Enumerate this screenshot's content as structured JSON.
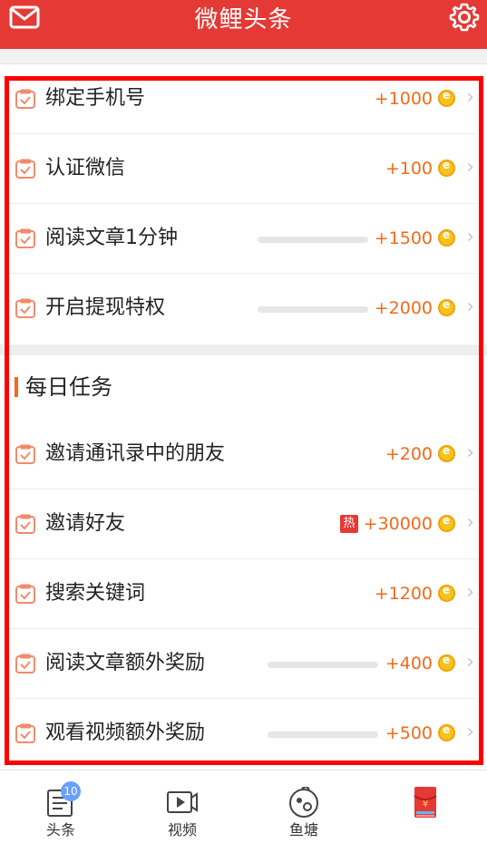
{
  "header": {
    "title": "微鲤头条",
    "left_icon": "mail-icon",
    "right_icon": "gear-icon",
    "bg_color": "#e53935"
  },
  "tasks_new": [
    {
      "label": "绑定手机号",
      "reward": "+1000",
      "has_progress": false
    },
    {
      "label": "认证微信",
      "reward": "+100",
      "has_progress": false
    },
    {
      "label": "阅读文章1分钟",
      "reward": "+1500",
      "has_progress": true
    },
    {
      "label": "开启提现特权",
      "reward": "+2000",
      "has_progress": true
    }
  ],
  "daily": {
    "title": "每日任务",
    "items": [
      {
        "label": "邀请通讯录中的朋友",
        "reward": "+200",
        "has_progress": false
      },
      {
        "label": "邀请好友",
        "reward": "+30000",
        "hot": "热",
        "has_progress": false
      },
      {
        "label": "搜索关键词",
        "reward": "+1200",
        "has_progress": false
      },
      {
        "label": "阅读文章额外奖励",
        "reward": "+400",
        "has_progress": true
      },
      {
        "label": "观看视频额外奖励",
        "reward": "+500",
        "has_progress": true
      }
    ]
  },
  "bottom_nav": [
    {
      "label": "头条",
      "icon": "news-icon",
      "badge": "10"
    },
    {
      "label": "视频",
      "icon": "video-icon"
    },
    {
      "label": "鱼塘",
      "icon": "fishpond-icon"
    },
    {
      "label": "",
      "icon": "red-packet-icon"
    }
  ],
  "colors": {
    "accent": "#e53935",
    "reward": "#f26a1b",
    "coin": "#f7c21c",
    "highlight": "#ff0000"
  }
}
